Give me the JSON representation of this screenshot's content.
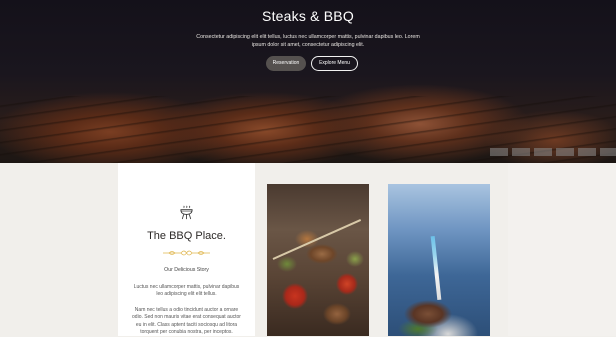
{
  "hero": {
    "title": "Steaks & BBQ",
    "subtitle": "Consectetur adipiscing elit elit tellus, luctus nec ullamcorper mattis, pulvinar dapibus leo. Lorem ipsum dolor sit amet, consectetur adipiscing elit.",
    "reservation_label": "Reservation",
    "menu_label": "Explore Menu"
  },
  "about": {
    "icon": "bbq-grill-icon",
    "title": "The BBQ Place.",
    "divider_icon": "ornament-divider-icon",
    "story_heading": "Our Delicious Story",
    "paragraph_1": "Luctus nec ullamcorper mattis, pulvinar dapibus leo adipiscing elit elit tellus.",
    "paragraph_2": "Nam nec tellus a odio tincidunt auctor a ornare odio. Sed non mauris vitae erat consequat auctor eu in elit. Class aptent taciti sociosqu ad litora torquent per conubia nostra, per inceptos."
  },
  "colors": {
    "page_bg": "#f1efeb",
    "card_bg": "#ffffff",
    "accent_gold": "#e0b64f",
    "button_dark": "#55514f"
  }
}
